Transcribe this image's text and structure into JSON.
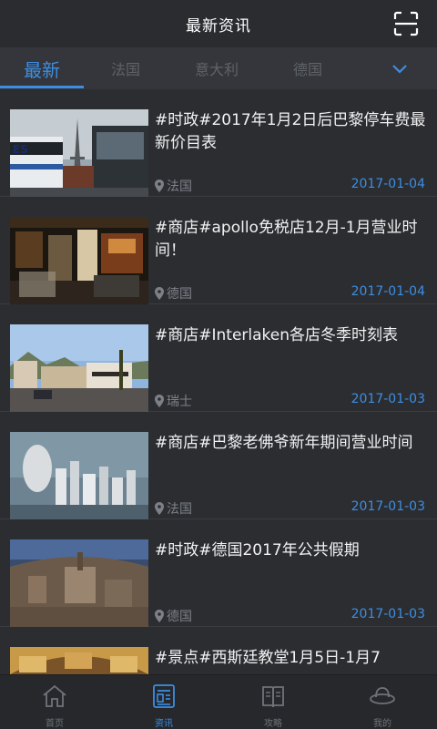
{
  "header": {
    "title": "最新资讯",
    "scan_icon": "scan-icon"
  },
  "tabs": {
    "items": [
      {
        "label": "最新",
        "active": true
      },
      {
        "label": "法国",
        "active": false
      },
      {
        "label": "意大利",
        "active": false
      },
      {
        "label": "德国",
        "active": false
      }
    ],
    "more_icon": "chevron-down-icon"
  },
  "news": [
    {
      "title": "#时政#2017年1月2日后巴黎停车费最新价目表",
      "location": "法国",
      "date": "2017-01-04",
      "image": "paris-bus-eiffel-photo"
    },
    {
      "title": "#商店#apollo免税店12月-1月营业时间！",
      "location": "德国",
      "date": "2017-01-04",
      "image": "dutyfree-shop-interior-photo"
    },
    {
      "title": "#商店#Interlaken各店冬季时刻表",
      "location": "瑞士",
      "date": "2017-01-03",
      "image": "interlaken-street-photo"
    },
    {
      "title": "#商店#巴黎老佛爷新年期间营业时间",
      "location": "法国",
      "date": "2017-01-03",
      "image": "galeries-lafayette-ad-photo"
    },
    {
      "title": "#时政#德国2017年公共假期",
      "location": "德国",
      "date": "2017-01-03",
      "image": "munich-aerial-photo"
    },
    {
      "title": "#景点#西斯廷教堂1月5日-1月7",
      "location": "",
      "date": "",
      "image": "sistine-chapel-photo"
    }
  ],
  "bottom_nav": [
    {
      "label": "首页",
      "icon": "home-icon",
      "active": false
    },
    {
      "label": "资讯",
      "icon": "news-icon",
      "active": true
    },
    {
      "label": "攻略",
      "icon": "book-icon",
      "active": false
    },
    {
      "label": "我的",
      "icon": "profile-hat-icon",
      "active": false
    }
  ],
  "colors": {
    "accent": "#3d8ee2",
    "background": "#2b2d31",
    "header": "#2a2c30",
    "tabbar": "#34363b",
    "muted": "#7d8187"
  }
}
